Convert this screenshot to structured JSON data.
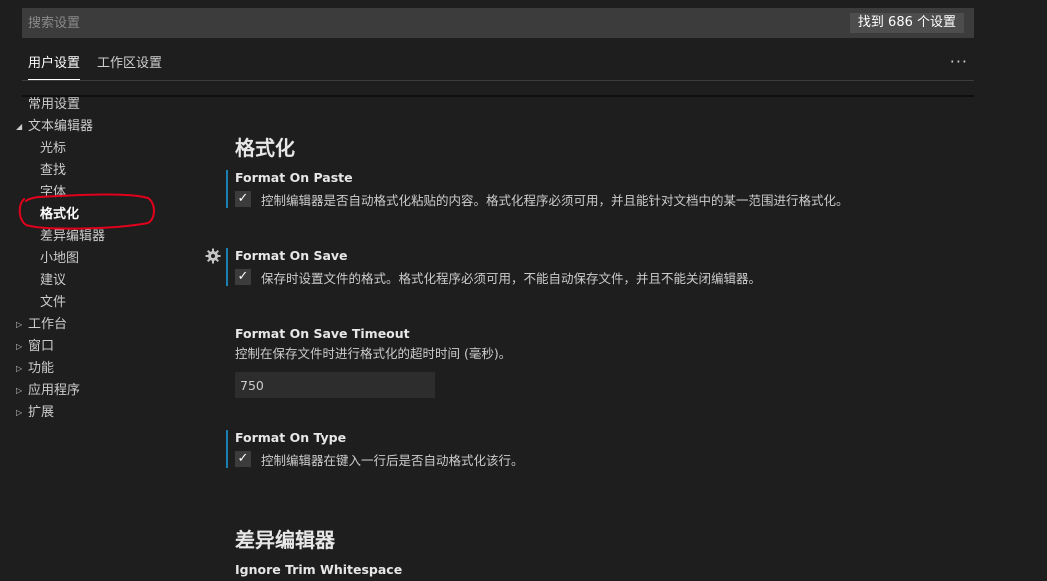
{
  "search": {
    "placeholder": "搜索设置",
    "result_count": "找到 686 个设置"
  },
  "tabs": {
    "user": "用户设置",
    "workspace": "工作区设置",
    "more": "···"
  },
  "tree": {
    "common": "常用设置",
    "text_editor": "文本编辑器",
    "cursor": "光标",
    "find": "查找",
    "font": "字体",
    "formatting": "格式化",
    "diff_editor": "差异编辑器",
    "minimap": "小地图",
    "suggestions": "建议",
    "files": "文件",
    "workbench": "工作台",
    "window": "窗口",
    "features": "功能",
    "application": "应用程序",
    "extensions": "扩展"
  },
  "content": {
    "section_formatting": "格式化",
    "format_on_paste": {
      "title": "Format On Paste",
      "desc": "控制编辑器是否自动格式化粘贴的内容。格式化程序必须可用，并且能针对文档中的某一范围进行格式化。",
      "checked": true
    },
    "format_on_save": {
      "title": "Format On Save",
      "desc": "保存时设置文件的格式。格式化程序必须可用，不能自动保存文件，并且不能关闭编辑器。",
      "checked": true
    },
    "format_on_save_timeout": {
      "title": "Format On Save Timeout",
      "desc": "控制在保存文件时进行格式化的超时时间 (毫秒)。",
      "value": "750"
    },
    "format_on_type": {
      "title": "Format On Type",
      "desc": "控制编辑器在键入一行后是否自动格式化该行。",
      "checked": true
    },
    "section_diff": "差异编辑器",
    "ignore_trim_whitespace": {
      "title": "Ignore Trim Whitespace"
    },
    "checkmark": "✓"
  },
  "colors": {
    "background": "#1e1e1e",
    "modified_indicator": "#1b80b2",
    "annotation": "#e0001b"
  }
}
